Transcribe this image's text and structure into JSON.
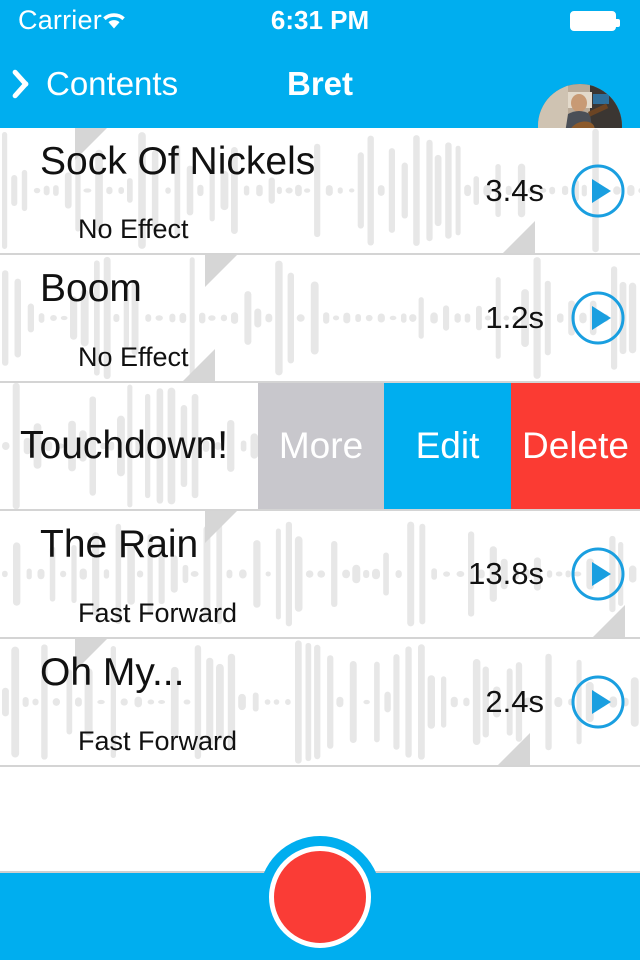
{
  "status_bar": {
    "carrier": "Carrier",
    "wifi_icon": "wifi-icon",
    "time": "6:31 PM",
    "battery_icon": "battery-full-icon"
  },
  "nav_bar": {
    "back_icon": "chevron-left-icon",
    "back_label": "Contents",
    "title": "Bret",
    "avatar_name": "user-avatar"
  },
  "theme": {
    "accent_blue": "#00AEEF",
    "delete_red": "#FB3B33",
    "more_grey": "#C8C7CC",
    "record_red": "#FA3C36",
    "waveform_grey": "#E6E6E6",
    "divider_grey": "#D4D4D4",
    "corner_triangle_grey": "#D6D6D6"
  },
  "recordings": [
    {
      "title": "Sock Of Nickels",
      "effect": "No Effect",
      "duration": "3.4s",
      "play_icon": "play-circle-icon",
      "swiped": false
    },
    {
      "title": "Boom",
      "effect": "No Effect",
      "duration": "1.2s",
      "play_icon": "play-circle-icon",
      "swiped": false
    },
    {
      "title": "Touchdown!",
      "effect": "",
      "duration": "",
      "play_icon": "play-circle-icon",
      "swiped": true
    },
    {
      "title": "The Rain",
      "effect": "Fast Forward",
      "duration": "13.8s",
      "play_icon": "play-circle-icon",
      "swiped": false
    },
    {
      "title": "Oh My...",
      "effect": "Fast Forward",
      "duration": "2.4s",
      "play_icon": "play-circle-icon",
      "swiped": false
    }
  ],
  "swipe_actions": {
    "more": "More",
    "edit": "Edit",
    "delete": "Delete"
  },
  "toolbar": {
    "record_button_name": "record-button"
  }
}
